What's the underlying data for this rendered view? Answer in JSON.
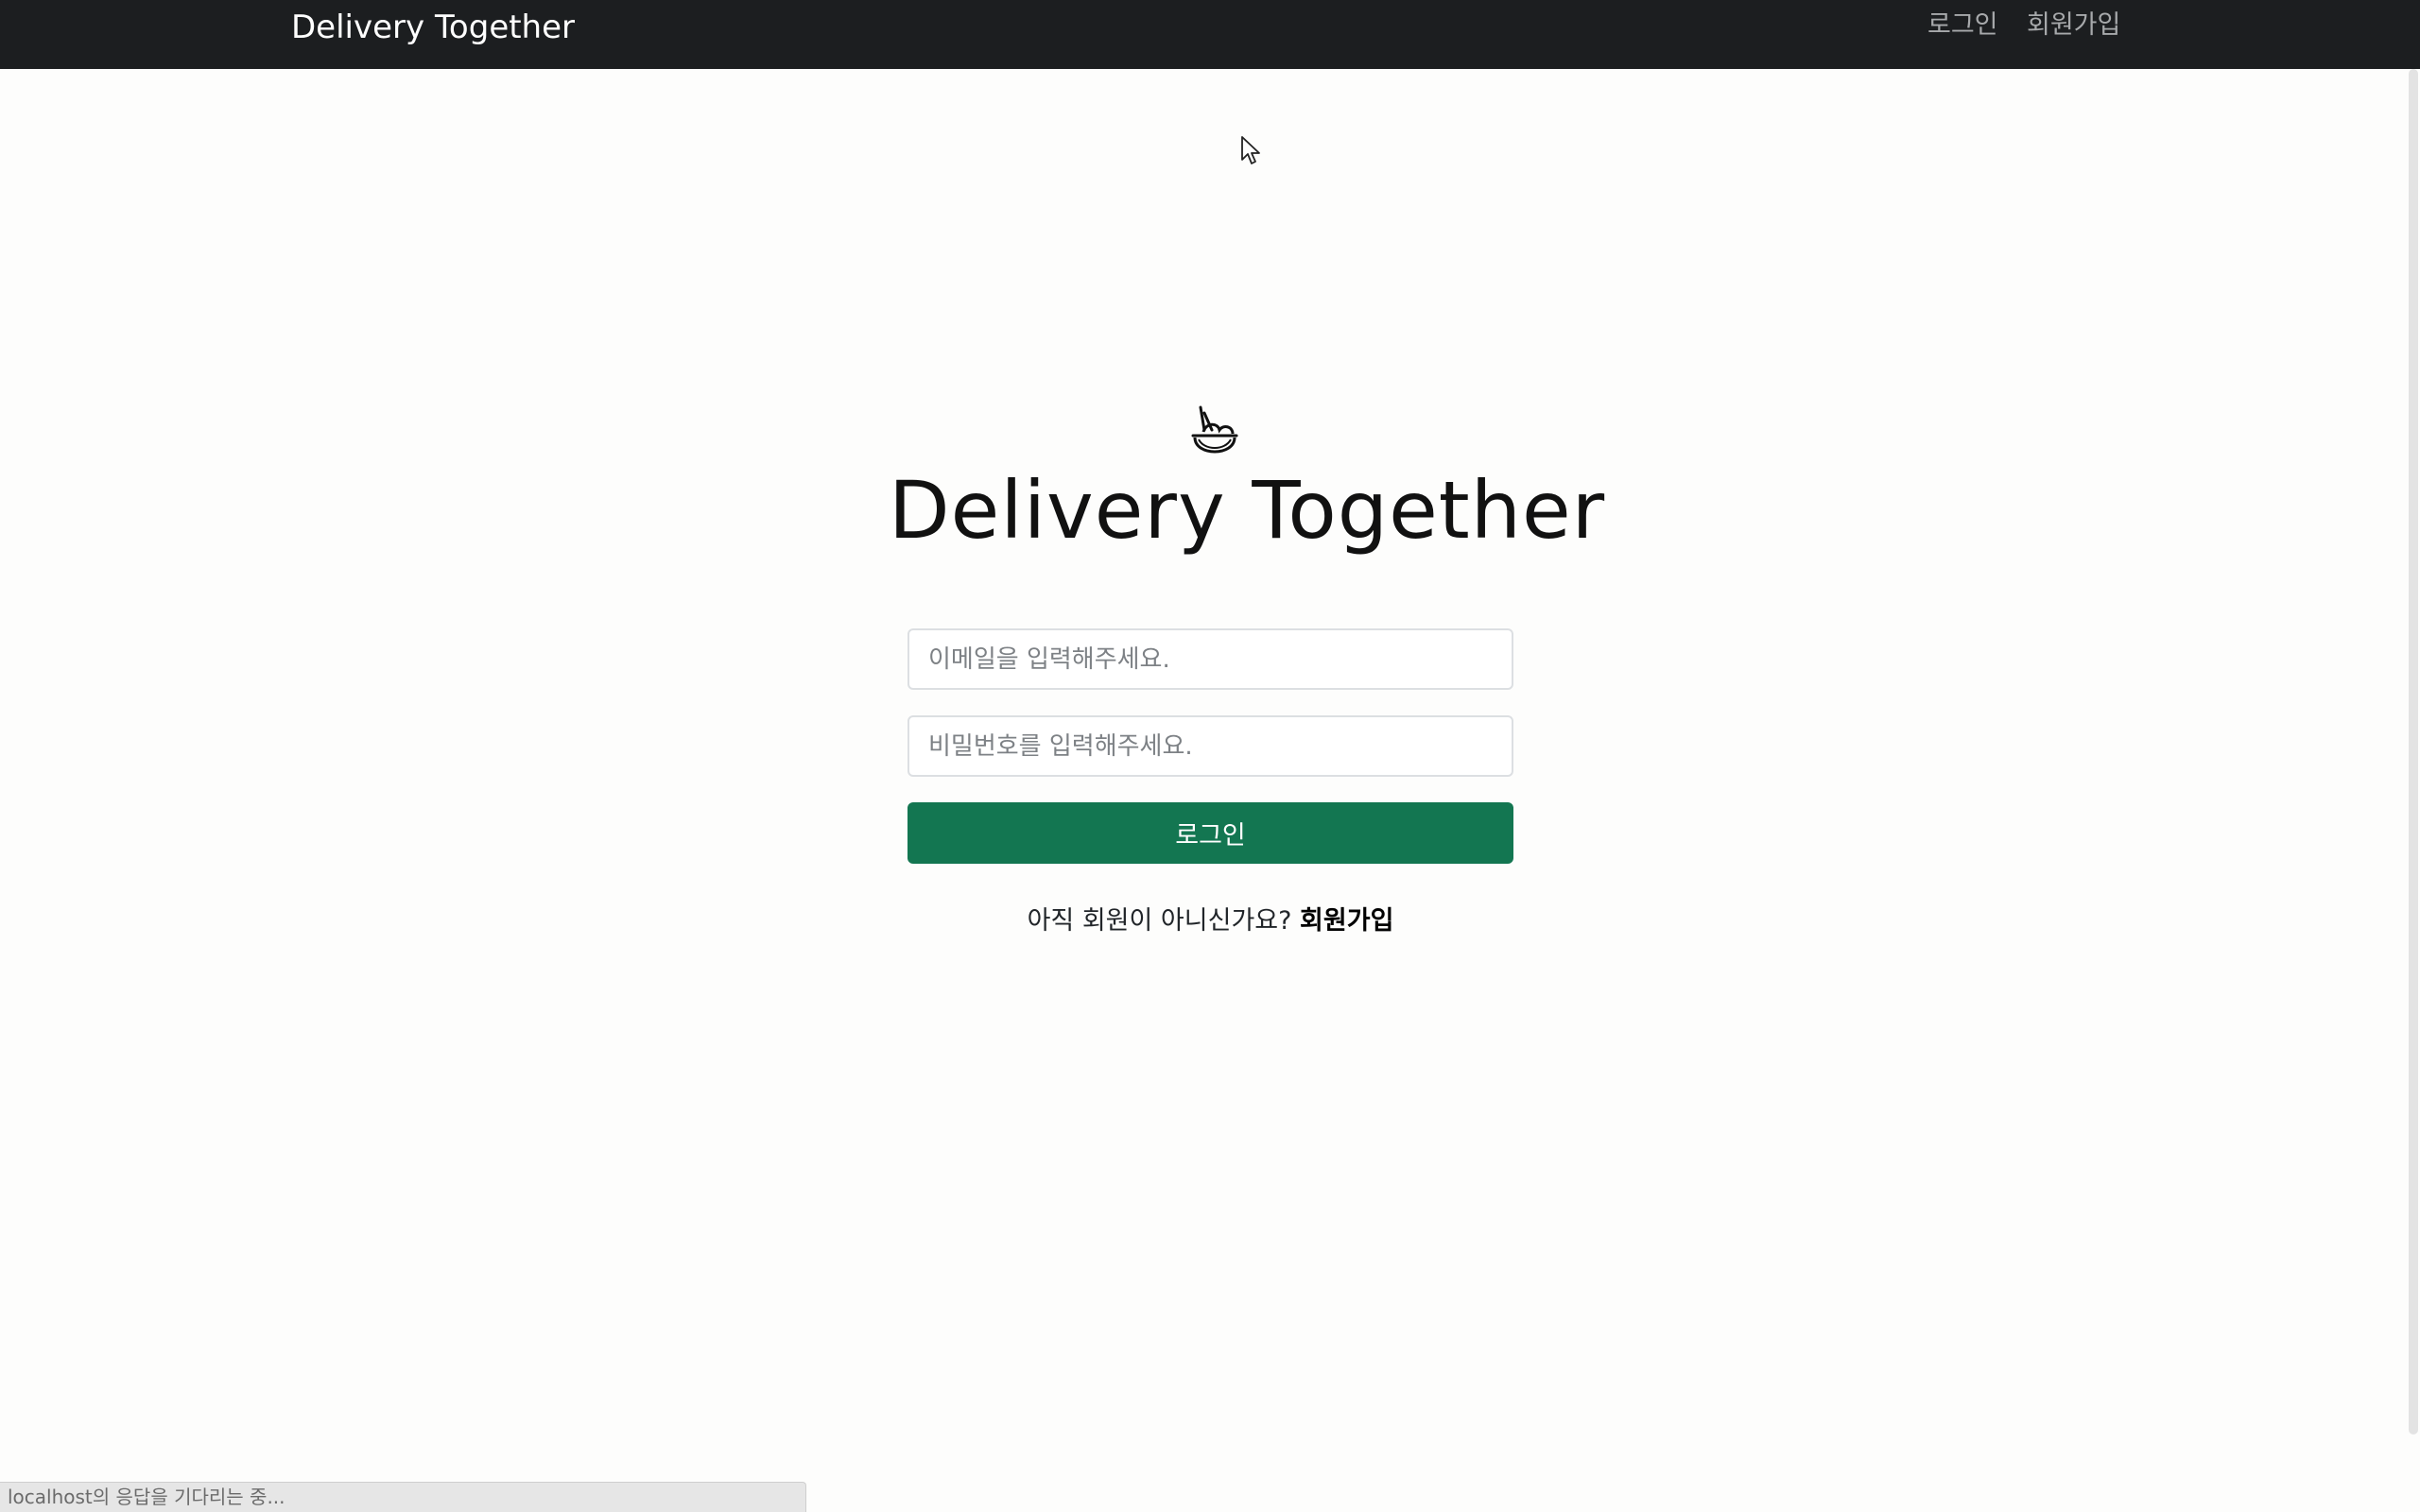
{
  "navbar": {
    "brand": "Delivery Together",
    "links": [
      {
        "label": "로그인"
      },
      {
        "label": "회원가입"
      }
    ]
  },
  "logo": {
    "text": "Delivery Together",
    "icon": "bowl-chopsticks-icon"
  },
  "form": {
    "email_placeholder": "이메일을 입력해주세요.",
    "password_placeholder": "비밀번호를 입력해주세요.",
    "submit_label": "로그인",
    "signup_prompt": "아직 회원이 아니신가요? ",
    "signup_link": "회원가입"
  },
  "status_bar": {
    "text": "localhost의 응답을 기다리는 중..."
  },
  "colors": {
    "navbar": "#1c1e20",
    "primary_button": "#137651",
    "background": "#fdfdfc"
  }
}
